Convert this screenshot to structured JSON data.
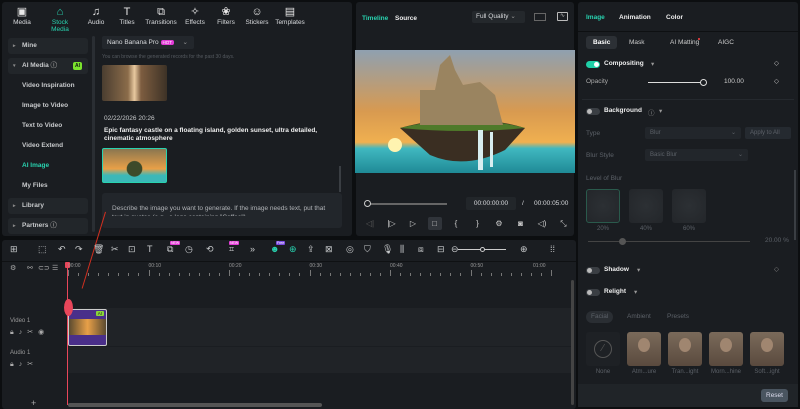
{
  "toolbar": [
    {
      "label": "Media",
      "icon": "media-icon",
      "glyph": "▣"
    },
    {
      "label": "Stock Media",
      "icon": "stock-media-icon",
      "glyph": "⌂"
    },
    {
      "label": "Audio",
      "icon": "audio-icon",
      "glyph": "♫"
    },
    {
      "label": "Titles",
      "icon": "titles-icon",
      "glyph": "T"
    },
    {
      "label": "Transitions",
      "icon": "transitions-icon",
      "glyph": "⧉"
    },
    {
      "label": "Effects",
      "icon": "effects-icon",
      "glyph": "✧"
    },
    {
      "label": "Filters",
      "icon": "filters-icon",
      "glyph": "❀"
    },
    {
      "label": "Stickers",
      "icon": "stickers-icon",
      "glyph": "☺"
    },
    {
      "label": "Templates",
      "icon": "templates-icon",
      "glyph": "▤"
    }
  ],
  "sidebar": {
    "mine": "Mine",
    "ai_media": "AI Media",
    "ai_badge": "AI",
    "items": [
      "Video Inspiration",
      "Image to Video",
      "Text to Video",
      "Video Extend",
      "AI Image",
      "My Files"
    ],
    "library": "Library",
    "partners": "Partners"
  },
  "media": {
    "model": "Nano Banana Pro",
    "model_badge": "HOT",
    "note": "You can browse the generated records for the past 30 days.",
    "date": "02/22/2026 20:26",
    "prompt_title": "Epic fantasy castle on a floating island, golden sunset, ultra detailed, cinematic atmosphere",
    "input_placeholder": "Describe the image you want to generate. If the image needs text, put that text in quotes (e.g., a logo containing \"Coffee\")"
  },
  "preview": {
    "tab_timeline": "Timeline",
    "tab_source": "Source",
    "quality": "Full Quality",
    "current_time": "00:00:00:00",
    "separator": "/",
    "total_time": "00:00:05:00",
    "progress": 0
  },
  "props": {
    "tabs": [
      "Image",
      "Animation",
      "Color"
    ],
    "subtabs": [
      "Basic",
      "Mask",
      "AI Matting",
      "AIGC"
    ],
    "compositing": "Compositing",
    "opacity_label": "Opacity",
    "opacity_value": "100.00",
    "opacity": 100,
    "background": "Background",
    "type_label": "Type",
    "type_value": "Blur",
    "apply_all": "Apply to All",
    "blur_style_label": "Blur Style",
    "blur_style_value": "Basic Blur",
    "level_label": "Level of Blur",
    "levels": [
      "20%",
      "40%",
      "60%"
    ],
    "level_value": "20.00",
    "level_unit": "%",
    "shadow": "Shadow",
    "relight": "Relight",
    "relight_tabs": [
      "Facial",
      "Ambient",
      "Presets"
    ],
    "presets": [
      "None",
      "Atm...ure",
      "Tran...ight",
      "Morn...hine",
      "Soft...ight"
    ],
    "reset": "Reset"
  },
  "timeline": {
    "ruler": [
      "00:00",
      "00:10",
      "00:20",
      "00:30",
      "00:40",
      "00:50",
      "01:00"
    ],
    "video_track": "Video 1",
    "audio_track": "Audio 1",
    "new_badge": "NEW",
    "free_badge": "Free",
    "clip_badge": "AI"
  },
  "colors": {
    "accent": "#28d3b0",
    "playhead": "#e8465a",
    "panel": "#1a1d21"
  }
}
